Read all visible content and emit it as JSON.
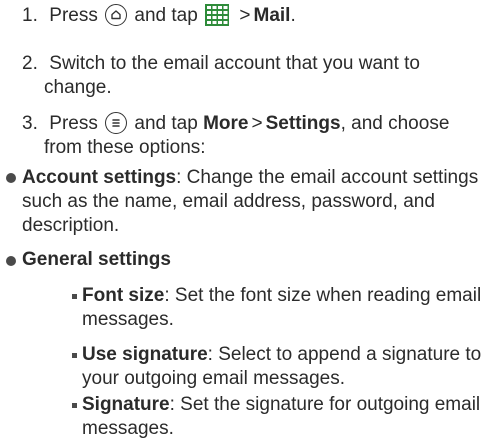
{
  "steps": {
    "s1": {
      "num": "1.",
      "press": "Press",
      "and_tap": "and tap",
      "gt": ">",
      "target": "Mail",
      "period": "."
    },
    "s2": {
      "num": "2.",
      "line1": "Switch to the email account that you want to",
      "line2": "change."
    },
    "s3": {
      "num": "3.",
      "press": "Press",
      "and_tap": "and tap",
      "more": "More",
      "gt": ">",
      "settings": "Settings",
      "rest": ", and choose",
      "line2": "from these options:"
    }
  },
  "options": {
    "account": {
      "title": "Account settings",
      "line1_rest": ": Change the email account settings",
      "line2": "such as the name, email address, password, and",
      "line3": "description."
    },
    "general": {
      "title": "General settings"
    }
  },
  "sub": {
    "font": {
      "title": "Font size",
      "line1_rest": ": Set the font size when reading email",
      "line2": "messages."
    },
    "usesig": {
      "title": "Use signature",
      "line1_rest": ": Select to append a signature to",
      "line2": "your outgoing email messages."
    },
    "sig": {
      "title": "Signature",
      "line1_rest": ": Set the signature for outgoing email",
      "line2": "messages."
    }
  },
  "icons": {
    "home": "home-icon",
    "apps": "apps-grid-icon",
    "menu": "menu-icon"
  },
  "colors": {
    "text": "#2b2b2b",
    "icon_green": "#2e8b3a"
  }
}
